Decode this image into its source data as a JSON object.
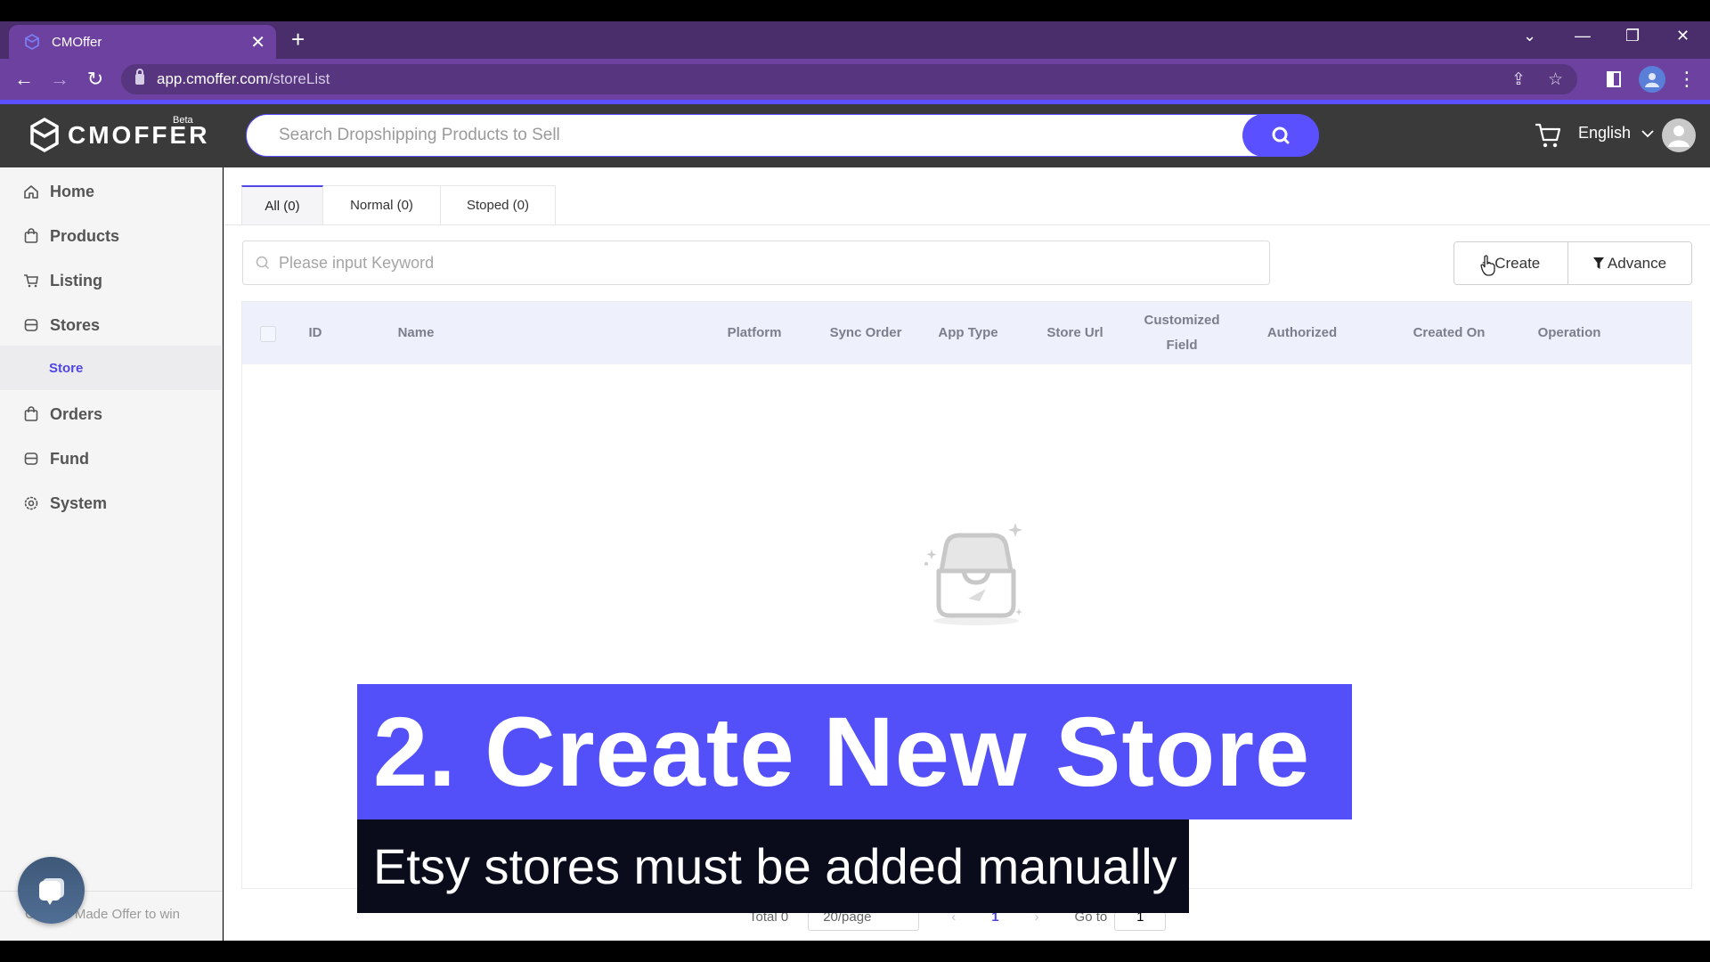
{
  "browser": {
    "tab_title": "CMOffer",
    "url_host": "app.cmoffer.com",
    "url_path": "/storeList"
  },
  "header": {
    "logo_text": "CMOFFER",
    "logo_badge": "Beta",
    "search_placeholder": "Search Dropshipping Products to Sell",
    "language": "English"
  },
  "sidebar": {
    "items": [
      {
        "label": "Home",
        "icon": "home-icon"
      },
      {
        "label": "Products",
        "icon": "bag-icon"
      },
      {
        "label": "Listing",
        "icon": "cart-icon"
      },
      {
        "label": "Stores",
        "icon": "store-icon"
      },
      {
        "label": "Orders",
        "icon": "bag-icon"
      },
      {
        "label": "Fund",
        "icon": "store-icon"
      },
      {
        "label": "System",
        "icon": "gear-icon"
      }
    ],
    "sub_item": "Store",
    "promo_text": "Custom Made Offer to win"
  },
  "main": {
    "tabs": [
      {
        "label": "All (0)",
        "active": true
      },
      {
        "label": "Normal (0)",
        "active": false
      },
      {
        "label": "Stoped (0)",
        "active": false
      }
    ],
    "keyword_placeholder": "Please input Keyword",
    "create_label": "Create",
    "advance_label": "Advance",
    "columns": [
      "ID",
      "Name",
      "Platform",
      "Sync Order",
      "App Type",
      "Store Url",
      "Customized Field",
      "Authorized",
      "Created On",
      "Operation"
    ],
    "rows": []
  },
  "pagination": {
    "total_label": "Total 0",
    "page_size": "20/page",
    "current_page": "1",
    "goto_label": "Go to",
    "goto_value": "1"
  },
  "caption": {
    "title": "2. Create New Store",
    "subtitle": "Etsy stores must be added manually"
  },
  "colors": {
    "accent": "#5a50ff",
    "browser_purple": "#6c41a0",
    "header_dark": "#3a3a3a",
    "caption_blue": "#5350fa",
    "caption_dark": "#0a0c1c"
  }
}
